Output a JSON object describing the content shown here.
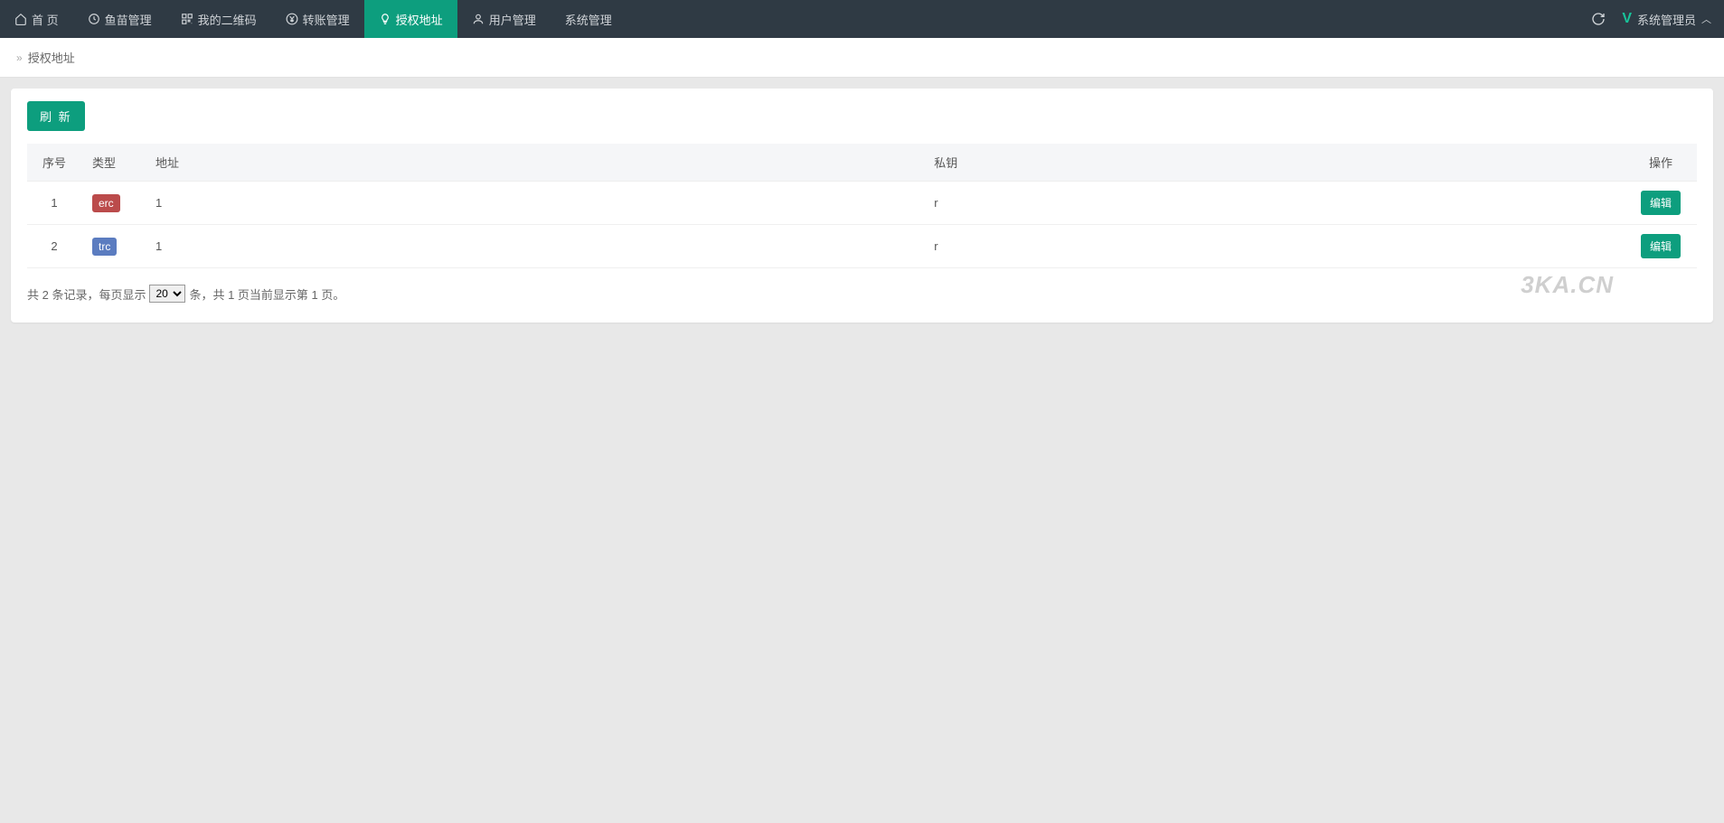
{
  "nav": [
    {
      "label": "首 页",
      "icon": "home"
    },
    {
      "label": "鱼苗管理",
      "icon": "clock"
    },
    {
      "label": "我的二维码",
      "icon": "qrcode"
    },
    {
      "label": "转账管理",
      "icon": "yen"
    },
    {
      "label": "授权地址",
      "icon": "bulb",
      "active": true
    },
    {
      "label": "用户管理",
      "icon": "user"
    },
    {
      "label": "系统管理",
      "icon": ""
    }
  ],
  "topRight": {
    "user": "系统管理员"
  },
  "breadcrumb": {
    "current": "授权地址"
  },
  "actions": {
    "refresh": "刷 新",
    "edit": "编辑"
  },
  "table": {
    "headers": {
      "seq": "序号",
      "type": "类型",
      "addr": "地址",
      "pk": "私钥",
      "op": "操作"
    },
    "rows": [
      {
        "seq": "1",
        "type": "erc",
        "typeClass": "tag-erc",
        "addr": "1",
        "pk": "r"
      },
      {
        "seq": "2",
        "type": "trc",
        "typeClass": "tag-trc",
        "addr": "1",
        "pk": "r"
      }
    ]
  },
  "pager": {
    "pre1": "共 2 条记录，每页显示",
    "pageSize": "20",
    "post1": "条，共 1 页当前显示第 1 页。"
  },
  "watermark": "3KA.CN"
}
